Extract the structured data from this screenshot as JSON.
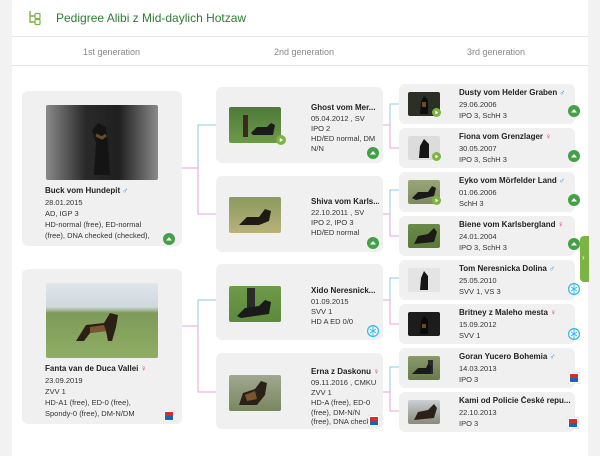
{
  "header": {
    "title": "Pedigree Alibi z Mid-daylich Hotzaw",
    "logo_icon": "pedigree-tree-icon"
  },
  "generations": [
    "1st generation",
    "2nd generation",
    "3rd generation"
  ],
  "colors": {
    "accent_green": "#7cb342",
    "male": "#1e88e5",
    "female": "#d81b60",
    "connector_blue": "#8fc9e8",
    "connector_pink": "#e8a0d8"
  },
  "first": [
    {
      "name": "Buck vom Hundepit",
      "sex": "♂",
      "lines": [
        "28.01.2015",
        "AD, IGP 3",
        "HD-normal (free), ED-normal",
        "(free), DNA checked (checked),"
      ],
      "badge": "green-arrow-icon"
    },
    {
      "name": "Fanta van de Duca Vallei",
      "sex": "♀",
      "lines": [
        "23.09.2019",
        "ZVV 1",
        "HD-A1 (free), ED-0 (free),",
        "Spondy-0 (free), DM-N/DM"
      ],
      "badge": "flag-badge-icon"
    }
  ],
  "second": [
    {
      "name": "Ghost vom Mer...",
      "sex": "",
      "lines": [
        "05.04.2012 , SV",
        "IPO 2",
        "HD/ED normal, DM",
        "N/N"
      ],
      "badge": "green-arrow-icon"
    },
    {
      "name": "Shiva vom Karls...",
      "sex": "",
      "lines": [
        "22.10.2011 , SV",
        "IPO 2, IPO 3",
        "HD/ED normal"
      ],
      "badge": "green-arrow-icon"
    },
    {
      "name": "Xido Neresnick...",
      "sex": "",
      "lines": [
        "01.09.2015",
        "SVV 1",
        "HD A ED 0/0"
      ],
      "badge": "globe-badge-icon"
    },
    {
      "name": "Erna z Daskonu",
      "sex": "♀",
      "lines": [
        "09.11.2016 , CMKU",
        "ZVV 1",
        "HD-A (free), ED-0",
        "(free), DM-N/N",
        "(free), DNA checked"
      ],
      "badge": "flag-badge-icon"
    }
  ],
  "third": [
    {
      "name": "Dusty vom Helder Graben",
      "sex": "♂",
      "lines": [
        "29.06.2006",
        "IPO 3, SchH 3"
      ],
      "badge": "green-arrow-icon"
    },
    {
      "name": "Fiona vom Grenzlager",
      "sex": "♀",
      "lines": [
        "30.05.2007",
        "IPO 3, SchH 3"
      ],
      "badge": "green-arrow-icon"
    },
    {
      "name": "Eyko vom Mörfelder Land",
      "sex": "♂",
      "lines": [
        "01.06.2006",
        "SchH 3"
      ],
      "badge": "green-arrow-icon"
    },
    {
      "name": "Biene vom Karlsbergland",
      "sex": "♀",
      "lines": [
        "24.01.2004",
        "IPO 3, SchH 3"
      ],
      "badge": "green-arrow-icon"
    },
    {
      "name": "Tom Neresnicka Dolina",
      "sex": "♂",
      "lines": [
        "25.05.2010",
        "SVV 1, VS 3"
      ],
      "badge": "globe-badge-icon"
    },
    {
      "name": "Britney z Maleho mesta",
      "sex": "♀",
      "lines": [
        "15.09.2012",
        "SVV 1"
      ],
      "badge": "globe-badge-icon"
    },
    {
      "name": "Goran Yucero Bohemia",
      "sex": "♂",
      "lines": [
        "14.03.2013",
        "IPO 3"
      ],
      "badge": "flag-badge-icon"
    },
    {
      "name": "Kami od Policie České repu...",
      "sex": "",
      "lines": [
        "22.10.2013",
        "IPO 3"
      ],
      "badge": "flag-badge-icon"
    }
  ]
}
